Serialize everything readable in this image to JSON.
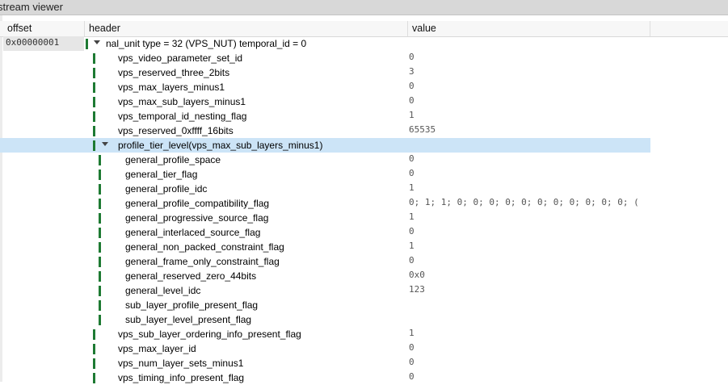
{
  "window": {
    "title": "stream viewer"
  },
  "columns": {
    "offset": "offset",
    "header": "header",
    "value": "value"
  },
  "rows": [
    {
      "offset": "0x00000001",
      "label": "nal_unit type = 32 (VPS_NUT) temporal_id = 0",
      "value": "",
      "depth": 0,
      "expandable": true,
      "expanded": true,
      "selected": false
    },
    {
      "offset": "",
      "label": "vps_video_parameter_set_id",
      "value": "0",
      "depth": 1,
      "expandable": false,
      "selected": false
    },
    {
      "offset": "",
      "label": "vps_reserved_three_2bits",
      "value": "3",
      "depth": 1,
      "expandable": false,
      "selected": false
    },
    {
      "offset": "",
      "label": "vps_max_layers_minus1",
      "value": "0",
      "depth": 1,
      "expandable": false,
      "selected": false
    },
    {
      "offset": "",
      "label": "vps_max_sub_layers_minus1",
      "value": "0",
      "depth": 1,
      "expandable": false,
      "selected": false
    },
    {
      "offset": "",
      "label": "vps_temporal_id_nesting_flag",
      "value": "1",
      "depth": 1,
      "expandable": false,
      "selected": false
    },
    {
      "offset": "",
      "label": "vps_reserved_0xffff_16bits",
      "value": "65535",
      "depth": 1,
      "expandable": false,
      "selected": false
    },
    {
      "offset": "",
      "label": "profile_tier_level(vps_max_sub_layers_minus1)",
      "value": "",
      "depth": 1,
      "expandable": true,
      "expanded": true,
      "selected": true
    },
    {
      "offset": "",
      "label": "general_profile_space",
      "value": "0",
      "depth": 2,
      "expandable": false,
      "selected": false
    },
    {
      "offset": "",
      "label": "general_tier_flag",
      "value": "0",
      "depth": 2,
      "expandable": false,
      "selected": false
    },
    {
      "offset": "",
      "label": "general_profile_idc",
      "value": "1",
      "depth": 2,
      "expandable": false,
      "selected": false
    },
    {
      "offset": "",
      "label": "general_profile_compatibility_flag",
      "value": "0; 1; 1; 0; 0; 0; 0; 0; 0; 0; 0; 0; 0; 0; (",
      "depth": 2,
      "expandable": false,
      "selected": false
    },
    {
      "offset": "",
      "label": "general_progressive_source_flag",
      "value": "1",
      "depth": 2,
      "expandable": false,
      "selected": false
    },
    {
      "offset": "",
      "label": "general_interlaced_source_flag",
      "value": "0",
      "depth": 2,
      "expandable": false,
      "selected": false
    },
    {
      "offset": "",
      "label": "general_non_packed_constraint_flag",
      "value": "1",
      "depth": 2,
      "expandable": false,
      "selected": false
    },
    {
      "offset": "",
      "label": "general_frame_only_constraint_flag",
      "value": "0",
      "depth": 2,
      "expandable": false,
      "selected": false
    },
    {
      "offset": "",
      "label": "general_reserved_zero_44bits",
      "value": "0x0",
      "depth": 2,
      "expandable": false,
      "selected": false
    },
    {
      "offset": "",
      "label": "general_level_idc",
      "value": "123",
      "depth": 2,
      "expandable": false,
      "selected": false
    },
    {
      "offset": "",
      "label": "sub_layer_profile_present_flag",
      "value": "",
      "depth": 2,
      "expandable": false,
      "selected": false
    },
    {
      "offset": "",
      "label": "sub_layer_level_present_flag",
      "value": "",
      "depth": 2,
      "expandable": false,
      "selected": false
    },
    {
      "offset": "",
      "label": "vps_sub_layer_ordering_info_present_flag",
      "value": "1",
      "depth": 1,
      "expandable": false,
      "selected": false
    },
    {
      "offset": "",
      "label": "vps_max_layer_id",
      "value": "0",
      "depth": 1,
      "expandable": false,
      "selected": false
    },
    {
      "offset": "",
      "label": "vps_num_layer_sets_minus1",
      "value": "0",
      "depth": 1,
      "expandable": false,
      "selected": false
    },
    {
      "offset": "",
      "label": "vps_timing_info_present_flag",
      "value": "0",
      "depth": 1,
      "expandable": false,
      "selected": false
    }
  ],
  "colors": {
    "tree_bar": "#1e7a33",
    "selection": "#cce4f7",
    "offset_bg": "#e6e6e6"
  }
}
